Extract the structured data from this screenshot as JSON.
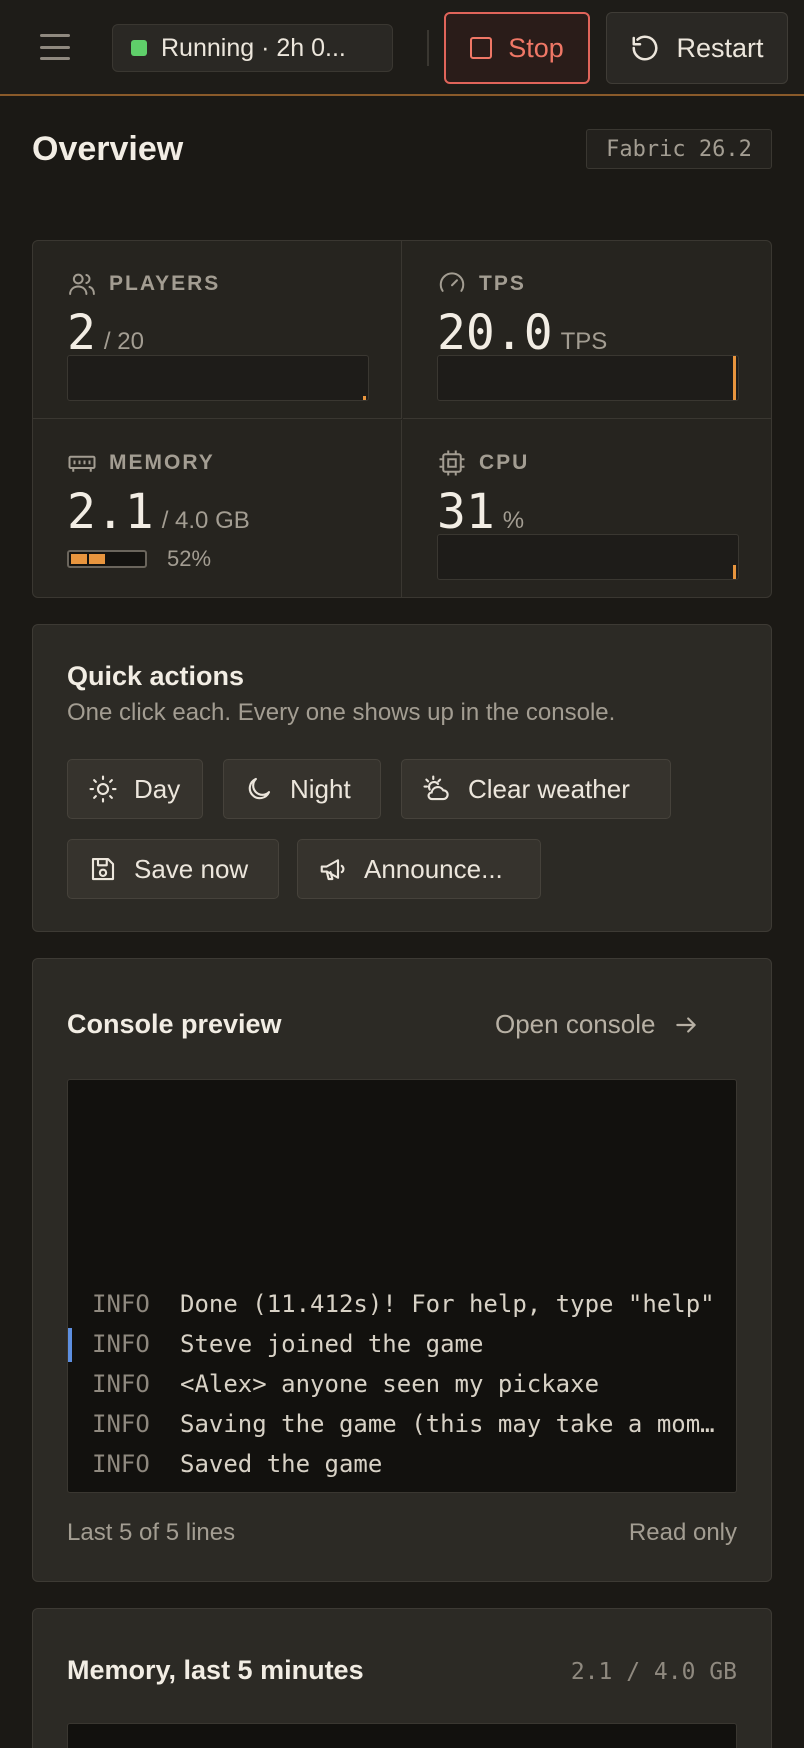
{
  "topbar": {
    "status_text": "Running · 2h 0...",
    "stop_label": "Stop",
    "restart_label": "Restart"
  },
  "overview": {
    "title": "Overview",
    "version": "Fabric 26.2"
  },
  "stats": {
    "players": {
      "label": "PLAYERS",
      "value": "2",
      "unit": "/ 20"
    },
    "tps": {
      "label": "TPS",
      "value": "20.0",
      "unit": "TPS"
    },
    "memory": {
      "label": "MEMORY",
      "value": "2.1",
      "unit": "/ 4.0 GB",
      "percent_label": "52%",
      "percent": 52
    },
    "cpu": {
      "label": "CPU",
      "value": "31",
      "unit": "%"
    }
  },
  "quick_actions": {
    "title": "Quick actions",
    "subtitle": "One click each. Every one shows up in the console.",
    "buttons": [
      {
        "label": "Day",
        "icon": "sun-icon"
      },
      {
        "label": "Night",
        "icon": "moon-icon"
      },
      {
        "label": "Clear weather",
        "icon": "sun-cloud-icon"
      },
      {
        "label": "Save now",
        "icon": "save-icon"
      },
      {
        "label": "Announce...",
        "icon": "megaphone-icon"
      }
    ]
  },
  "console_preview": {
    "title": "Console preview",
    "open_label": "Open console",
    "lines": [
      {
        "level": "INFO",
        "message": "Done (11.412s)! For help, type \"help\""
      },
      {
        "level": "INFO",
        "message": "Steve joined the game"
      },
      {
        "level": "INFO",
        "message": "<Alex> anyone seen my pickaxe"
      },
      {
        "level": "INFO",
        "message": "Saving the game (this may take a moment!)"
      },
      {
        "level": "INFO",
        "message": "Saved the game"
      }
    ],
    "footer_left": "Last 5 of 5 lines",
    "footer_right": "Read only"
  },
  "memory_chart": {
    "title": "Memory, last 5 minutes",
    "summary": "2.1 / 4.0 GB"
  },
  "colors": {
    "accent": "#e8953e",
    "running": "#5fcf6a",
    "danger": "#ef7766",
    "highlight": "#5d8fe0"
  }
}
